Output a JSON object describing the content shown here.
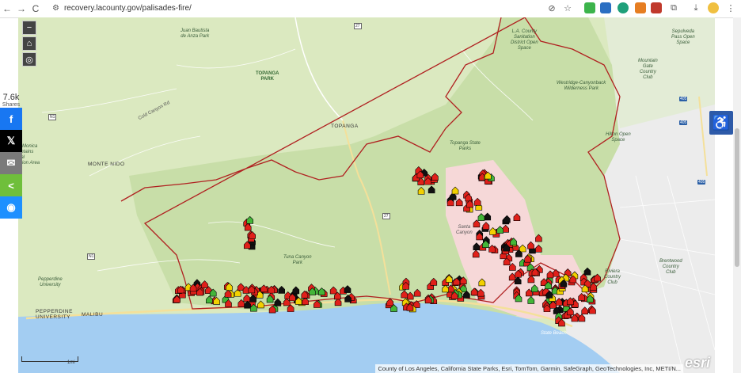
{
  "browser": {
    "url": "recovery.lacounty.gov/palisades-fire/",
    "back_icon": "←",
    "forward_icon": "→",
    "reload_icon": "C"
  },
  "map": {
    "controls": {
      "zoom_out": "−",
      "home": "⌂",
      "locate": "◎"
    },
    "labels": {
      "juan_bautista": "Juan Bautista\nde Anza Park",
      "topanga_park": "TOPANGA\nPARK",
      "topanga": "TOPANGA",
      "monte_nido": "MONTE NIDO",
      "topanga_state_parks": "Topanga State\nParks",
      "tuna_canyon": "Tuna Canyon\nPark",
      "pepperdine_univ": "Pepperdine\nUniversity",
      "pepperdine": "PEPPERDINE\nUNIVERSITY",
      "malibu": "MALIBU",
      "la_county_sanitation": "L.A. County\nSanitation\nDistrict Open\nSpace",
      "westridge": "Westridge-Canyonback\nWilderness Park",
      "hilton_open": "Hilton Open\nSpace",
      "mountain_gate": "Mountain\nGate\nCountry\nClub",
      "sepulveda": "Sepulveda\nPass Open\nSpace",
      "brentwood": "Brentwood\nCountry\nClub",
      "riviera": "Riviera\nCountry\nClub",
      "state_beach": "State Beach",
      "cold_canyon": "Cold Canyon Rd",
      "santa_monica_mtns": "e Monica\nuntains\nnal\nation Area",
      "topanga_canyon": "Santa\nCanyon"
    },
    "roads": {
      "n1": "N1",
      "r27": "27",
      "r405": "405",
      "n1b": "N1"
    },
    "scale_label": "1mi",
    "attribution": "County of Los Angeles, California State Parks, Esri, TomTom, Garmin, SafeGraph, GeoTechnologies, Inc, METI/N...",
    "esri": "esri"
  },
  "share": {
    "count": "7.6k",
    "label": "Shares"
  },
  "colors": {
    "land": "#dbe9c0",
    "park": "#c8dea8",
    "water": "#a3cdf2",
    "burn_boundary": "#b02020",
    "damaged": "#e0201a",
    "destroyed_black": "#111111",
    "minor": "#f2d000",
    "no_damage": "#43b538",
    "urban": "#ececec"
  }
}
